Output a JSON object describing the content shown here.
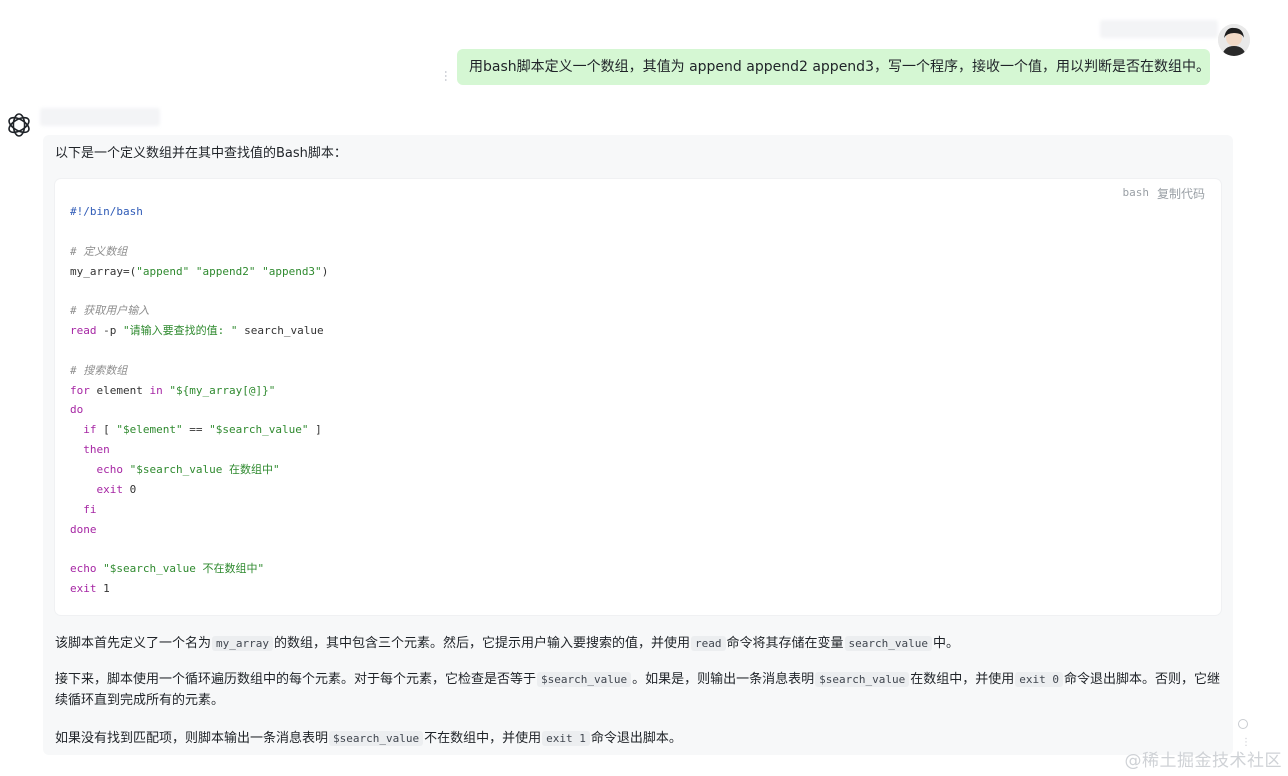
{
  "user": {
    "message": "用bash脚本定义一个数组，其值为 append append2 append3，写一个程序，接收一个值，用以判断是否在数组中。",
    "more_icon": "more-vertical-icon"
  },
  "assistant": {
    "avatar_icon": "openai-logo-icon",
    "intro": "以下是一个定义数组并在其中查找值的Bash脚本：",
    "code_block": {
      "language": "bash",
      "copy_label": "复制代码",
      "lines": [
        [
          [
            "shebang",
            "#!/bin/bash"
          ]
        ],
        [],
        [
          [
            "comment",
            "# 定义数组"
          ]
        ],
        [
          [
            "plain",
            "my_array=("
          ],
          [
            "string",
            "\"append\""
          ],
          [
            "plain",
            " "
          ],
          [
            "string",
            "\"append2\""
          ],
          [
            "plain",
            " "
          ],
          [
            "string",
            "\"append3\""
          ],
          [
            "plain",
            ")"
          ]
        ],
        [],
        [
          [
            "comment",
            "# 获取用户输入"
          ]
        ],
        [
          [
            "builtin",
            "read"
          ],
          [
            "plain",
            " -p "
          ],
          [
            "string",
            "\"请输入要查找的值: \""
          ],
          [
            "plain",
            " search_value"
          ]
        ],
        [],
        [
          [
            "comment",
            "# 搜索数组"
          ]
        ],
        [
          [
            "keyword",
            "for"
          ],
          [
            "plain",
            " element "
          ],
          [
            "keyword",
            "in"
          ],
          [
            "plain",
            " "
          ],
          [
            "string",
            "\"${my_array[@]}\""
          ]
        ],
        [
          [
            "keyword",
            "do"
          ]
        ],
        [
          [
            "plain",
            "  "
          ],
          [
            "keyword",
            "if"
          ],
          [
            "plain",
            " [ "
          ],
          [
            "string",
            "\"$element\""
          ],
          [
            "plain",
            " == "
          ],
          [
            "string",
            "\"$search_value\""
          ],
          [
            "plain",
            " ]"
          ]
        ],
        [
          [
            "plain",
            "  "
          ],
          [
            "keyword",
            "then"
          ]
        ],
        [
          [
            "plain",
            "    "
          ],
          [
            "builtin",
            "echo"
          ],
          [
            "plain",
            " "
          ],
          [
            "string",
            "\"$search_value 在数组中\""
          ]
        ],
        [
          [
            "plain",
            "    "
          ],
          [
            "builtin",
            "exit"
          ],
          [
            "plain",
            " 0"
          ]
        ],
        [
          [
            "plain",
            "  "
          ],
          [
            "keyword",
            "fi"
          ]
        ],
        [
          [
            "keyword",
            "done"
          ]
        ],
        [],
        [
          [
            "builtin",
            "echo"
          ],
          [
            "plain",
            " "
          ],
          [
            "string",
            "\"$search_value 不在数组中\""
          ]
        ],
        [
          [
            "builtin",
            "exit"
          ],
          [
            "plain",
            " 1"
          ]
        ]
      ]
    },
    "paragraphs": [
      [
        [
          "text",
          "该脚本首先定义了一个名为"
        ],
        [
          "code",
          "my_array"
        ],
        [
          "text",
          "的数组，其中包含三个元素。然后，它提示用户输入要搜索的值，并使用"
        ],
        [
          "code",
          "read"
        ],
        [
          "text",
          "命令将其存储在变量"
        ],
        [
          "code",
          "search_value"
        ],
        [
          "text",
          "中。"
        ]
      ],
      [
        [
          "text",
          "接下来，脚本使用一个循环遍历数组中的每个元素。对于每个元素，它检查是否等于"
        ],
        [
          "code",
          "$search_value"
        ],
        [
          "text",
          "。如果是，则输出一条消息表明"
        ],
        [
          "code",
          "$search_value"
        ],
        [
          "text",
          "在数组中，并使用"
        ],
        [
          "code",
          "exit 0"
        ],
        [
          "text",
          "命令退出脚本。否则，它继续循环直到完成所有的元素。"
        ]
      ],
      [
        [
          "text",
          "如果没有找到匹配项，则脚本输出一条消息表明"
        ],
        [
          "code",
          "$search_value"
        ],
        [
          "text",
          "不在数组中，并使用"
        ],
        [
          "code",
          "exit 1"
        ],
        [
          "text",
          "命令退出脚本。"
        ]
      ]
    ]
  },
  "watermark": "@稀土掘金技术社区",
  "colors": {
    "user_bubble": "#d5f7d3",
    "assistant_panel": "#f7f8f9",
    "code_background": "#ffffff",
    "inline_code_background": "#eceef0",
    "string": "#2f8a2f",
    "keyword": "#a626a4",
    "comment": "#8e8e8e",
    "shebang": "#2f5bb7"
  }
}
